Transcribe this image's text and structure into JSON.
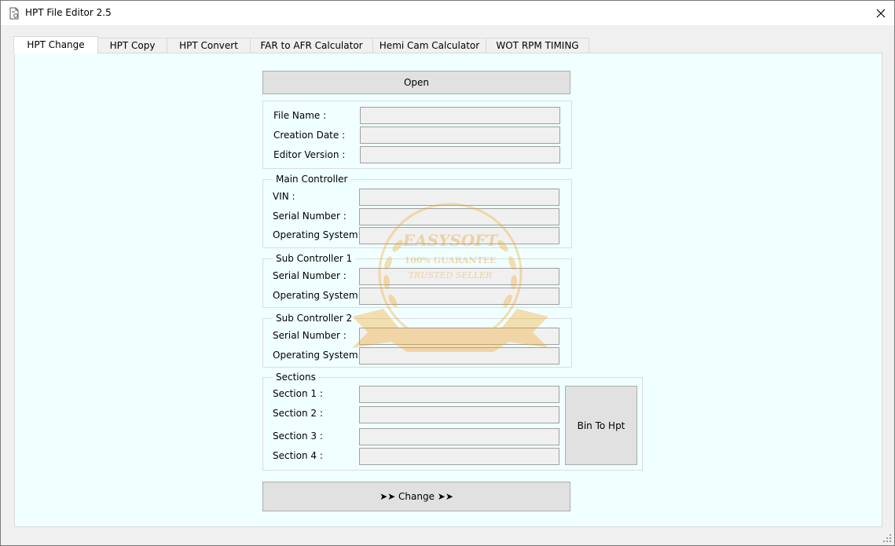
{
  "window": {
    "title": "HPT File Editor 2.5"
  },
  "tabs": [
    {
      "label": "HPT Change"
    },
    {
      "label": "HPT Copy"
    },
    {
      "label": "HPT Convert"
    },
    {
      "label": "FAR to AFR Calculator"
    },
    {
      "label": "Hemi Cam Calculator"
    },
    {
      "label": "WOT RPM TIMING"
    }
  ],
  "open_button": "Open",
  "file_info": {
    "file_name_label": "File Name :",
    "file_name_value": "",
    "creation_date_label": "Creation Date :",
    "creation_date_value": "",
    "editor_version_label": "Editor Version :",
    "editor_version_value": ""
  },
  "main_controller": {
    "title": "Main Controller",
    "vin_label": "VIN :",
    "vin_value": "",
    "serial_label": "Serial Number :",
    "serial_value": "",
    "os_label": "Operating System :",
    "os_value": ""
  },
  "sub_controller_1": {
    "title": "Sub Controller 1",
    "serial_label": "Serial Number :",
    "serial_value": "",
    "os_label": "Operating System :",
    "os_value": ""
  },
  "sub_controller_2": {
    "title": "Sub Controller 2",
    "serial_label": "Serial Number :",
    "serial_value": "",
    "os_label": "Operating System :",
    "os_value": ""
  },
  "sections": {
    "title": "Sections",
    "items": [
      {
        "label": "Section 1 :",
        "value": ""
      },
      {
        "label": "Section 2 :",
        "value": ""
      },
      {
        "label": "Section 3 :",
        "value": ""
      },
      {
        "label": "Section 4 :",
        "value": ""
      }
    ],
    "bin_to_hpt_button": "Bin To Hpt"
  },
  "change_button": "➤➤  Change  ➤➤",
  "watermark": {
    "brand": "EASYSOFT",
    "line1": "100% GUARANTEE",
    "line2": "TRUSTED SELLER",
    "color": "#f5a623"
  },
  "icons": {
    "app": "document-gear-icon",
    "close": "close-icon",
    "grip": "resize-grip-icon"
  }
}
